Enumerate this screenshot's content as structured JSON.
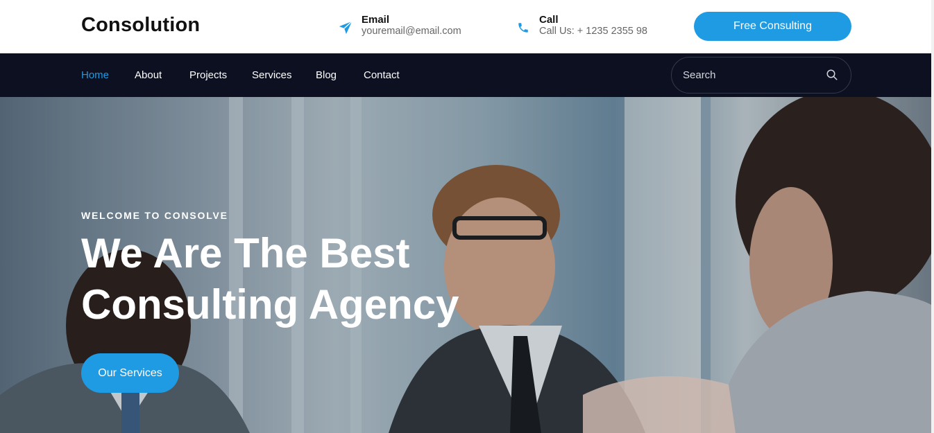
{
  "header": {
    "brand": "Consolution",
    "email": {
      "label": "Email",
      "value": "youremail@email.com",
      "icon": "paper-plane-icon"
    },
    "call": {
      "label": "Call",
      "value": "Call Us: + 1235 2355 98",
      "icon": "phone-icon"
    },
    "cta_label": "Free Consulting"
  },
  "nav": {
    "items": [
      {
        "label": "Home",
        "active": true
      },
      {
        "label": "About"
      },
      {
        "label": "Projects"
      },
      {
        "label": "Services"
      },
      {
        "label": "Blog"
      },
      {
        "label": "Contact"
      }
    ],
    "search_placeholder": "Search",
    "search_icon": "search-icon"
  },
  "hero": {
    "kicker": "WELCOME TO CONSOLVE",
    "headline_line1": "We Are The Best",
    "headline_line2": "Consulting Agency",
    "button_label": "Our Services"
  },
  "colors": {
    "accent": "#1e9be3",
    "navbar_bg": "#0c1021",
    "brand_text": "#111111"
  }
}
